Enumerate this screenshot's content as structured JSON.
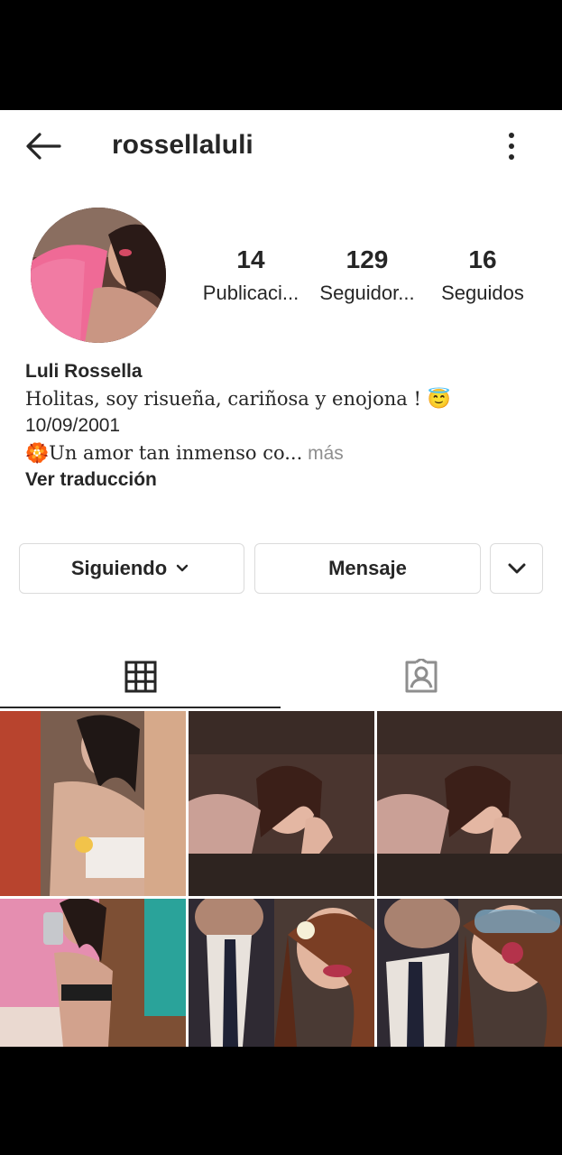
{
  "header": {
    "username": "rossellaluli",
    "back_icon": "arrow-left-icon",
    "more_icon": "more-vertical-icon"
  },
  "stats": [
    {
      "value": "14",
      "label": "Publicaci..."
    },
    {
      "value": "129",
      "label": "Seguidor..."
    },
    {
      "value": "16",
      "label": "Seguidos"
    }
  ],
  "bio": {
    "name": "Luli Rossella",
    "line1": "Holitas, soy risueña, cariñosa y enojona ! 😇",
    "date": "10/09/2001",
    "line2": "🏵️Un amor tan inmenso co...",
    "more": " más",
    "translate": "Ver traducción"
  },
  "actions": {
    "following": "Siguiendo",
    "message": "Mensaje"
  },
  "tabs": {
    "grid_icon": "grid-icon",
    "tagged_icon": "tagged-user-icon"
  },
  "colors": {
    "text": "#262626",
    "muted": "#8e8e8e",
    "border": "#dbdbdb"
  }
}
